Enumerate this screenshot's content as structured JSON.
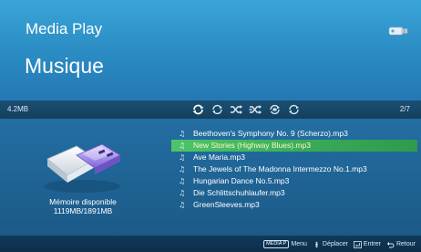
{
  "header": {
    "app_title": "Media Play",
    "section_title": "Musique",
    "device_icon": "usb-stick-icon"
  },
  "status": {
    "storage_size": "4.2MB",
    "track_counter": "2/7",
    "controls": [
      {
        "name": "repeat-icon"
      },
      {
        "name": "repeat-one-icon"
      },
      {
        "name": "shuffle-icon"
      },
      {
        "name": "shuffle-all-icon"
      },
      {
        "name": "repeat-folder-icon"
      },
      {
        "name": "repeat-all-icon"
      }
    ]
  },
  "memory": {
    "label": "Mémoire disponible",
    "values": "1119MB/1891MB"
  },
  "files": [
    {
      "name": "Beethoven's Symphony No. 9 (Scherzo).mp3",
      "selected": false
    },
    {
      "name": "New Stories (Highway Blues).mp3",
      "selected": true
    },
    {
      "name": "Ave Maria.mp3",
      "selected": false
    },
    {
      "name": "The Jewels of The Madonna Intermezzo No.1.mp3",
      "selected": false
    },
    {
      "name": "Hungarian Dance No.5.mp3",
      "selected": false
    },
    {
      "name": "Die Schlittschuhlaufer.mp3",
      "selected": false
    },
    {
      "name": "GreenSleeves.mp3",
      "selected": false
    }
  ],
  "hints": {
    "menu_key": "MEDIA P",
    "menu_label": "Menu",
    "move_label": "Déplacer",
    "enter_label": "Entrer",
    "back_label": "Retour"
  },
  "colors": {
    "header": "#2c8fc6",
    "body": "#1d5f8c",
    "selected_row": "#3cb45a"
  }
}
